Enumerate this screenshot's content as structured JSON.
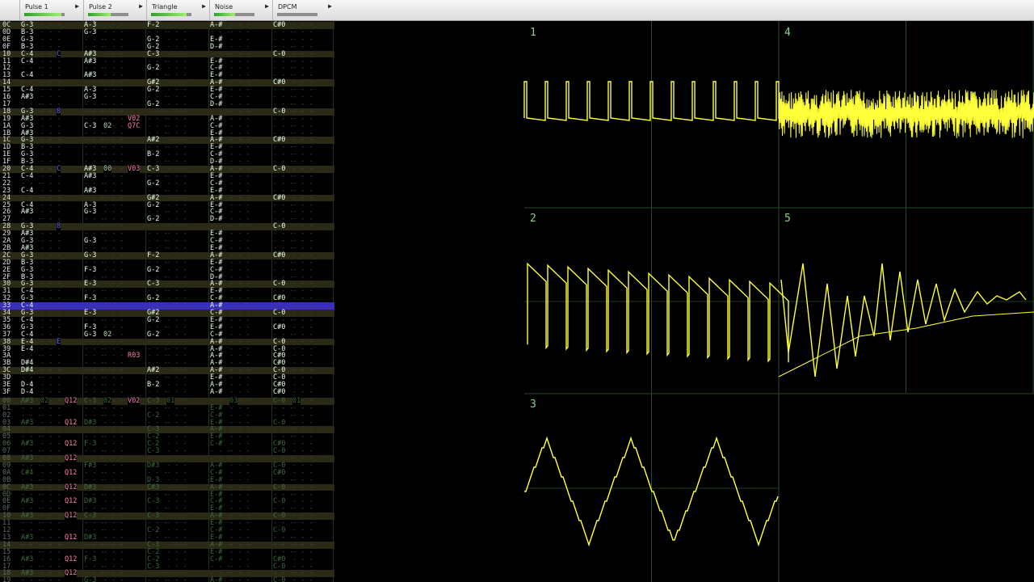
{
  "channels": [
    {
      "name": "Pulse 1",
      "level": 0.92
    },
    {
      "name": "Pulse 2",
      "level": 0.55
    },
    {
      "name": "Triangle",
      "level": 0.88
    },
    {
      "name": "Noise",
      "level": 0.52
    },
    {
      "name": "DPCM",
      "level": 0.0
    }
  ],
  "empty_cell": "- - -",
  "scope_panels": [
    "1",
    "2",
    "3",
    "4",
    "5"
  ],
  "rows": [
    {
      "r": "0C",
      "c": [
        "G-3",
        "A-3",
        "F-2",
        "A-#",
        "C#0"
      ]
    },
    {
      "r": "0D",
      "c": [
        "B-3",
        "G-3",
        "",
        "",
        ""
      ]
    },
    {
      "r": "0E",
      "c": [
        "G-3",
        "",
        "G-2",
        "E-#",
        ""
      ]
    },
    {
      "r": "0F",
      "c": [
        "B-3",
        "",
        "G-2",
        "D-#",
        ""
      ]
    },
    {
      "r": "10",
      "c": [
        "C-4",
        "A#3",
        "C-3",
        "",
        "C-0"
      ]
    },
    {
      "r": "11",
      "c": [
        "C-4",
        "A#3",
        "",
        "E-#",
        ""
      ]
    },
    {
      "r": "12",
      "c": [
        "",
        "",
        "G-2",
        "C-#",
        ""
      ]
    },
    {
      "r": "13",
      "c": [
        "C-4",
        "A#3",
        "",
        "E-#",
        ""
      ]
    },
    {
      "r": "14",
      "c": [
        "",
        "",
        "G#2",
        "A-#",
        "C#0"
      ]
    },
    {
      "r": "15",
      "c": [
        "C-4",
        "A-3",
        "G-2",
        "E-#",
        ""
      ]
    },
    {
      "r": "16",
      "c": [
        "A#3",
        "G-3",
        "",
        "C-#",
        ""
      ]
    },
    {
      "r": "17",
      "c": [
        "",
        "",
        "G-2",
        "D-#",
        ""
      ]
    },
    {
      "r": "18",
      "c": [
        "G-3",
        "",
        "",
        "",
        "C-0"
      ]
    },
    {
      "r": "19",
      "c": [
        "A#3",
        "",
        "",
        "A-#",
        ""
      ]
    },
    {
      "r": "1A",
      "c": [
        "G-3",
        "C-3",
        "",
        "C-#",
        ""
      ]
    },
    {
      "r": "1B",
      "c": [
        "A#3",
        "",
        "",
        "E-#",
        ""
      ]
    },
    {
      "r": "1C",
      "c": [
        "G-3",
        "",
        "A#2",
        "A-#",
        "C#0"
      ]
    },
    {
      "r": "1D",
      "c": [
        "B-3",
        "",
        "",
        "E-#",
        ""
      ]
    },
    {
      "r": "1E",
      "c": [
        "G-3",
        "",
        "B-2",
        "C-#",
        ""
      ]
    },
    {
      "r": "1F",
      "c": [
        "B-3",
        "",
        "",
        "D-#",
        ""
      ]
    },
    {
      "r": "20",
      "c": [
        "C-4",
        "A#3",
        "C-3",
        "A-#",
        "C-0"
      ]
    },
    {
      "r": "21",
      "c": [
        "C-4",
        "A#3",
        "",
        "E-#",
        ""
      ]
    },
    {
      "r": "22",
      "c": [
        "",
        "",
        "G-2",
        "C-#",
        ""
      ]
    },
    {
      "r": "23",
      "c": [
        "C-4",
        "A#3",
        "",
        "E-#",
        ""
      ]
    },
    {
      "r": "24",
      "c": [
        "",
        "",
        "G#2",
        "A-#",
        "C#0"
      ]
    },
    {
      "r": "25",
      "c": [
        "C-4",
        "A-3",
        "G-2",
        "E-#",
        ""
      ]
    },
    {
      "r": "26",
      "c": [
        "A#3",
        "G-3",
        "",
        "C-#",
        ""
      ]
    },
    {
      "r": "27",
      "c": [
        "",
        "",
        "G-2",
        "D-#",
        ""
      ]
    },
    {
      "r": "28",
      "c": [
        "G-3",
        "",
        "",
        "",
        "C-0"
      ]
    },
    {
      "r": "29",
      "c": [
        "A#3",
        "",
        "",
        "E-#",
        ""
      ]
    },
    {
      "r": "2A",
      "c": [
        "G-3",
        "G-3",
        "",
        "C-#",
        ""
      ]
    },
    {
      "r": "2B",
      "c": [
        "A#3",
        "",
        "",
        "E-#",
        ""
      ]
    },
    {
      "r": "2C",
      "c": [
        "G-3",
        "G-3",
        "F-2",
        "A-#",
        "C#0"
      ]
    },
    {
      "r": "2D",
      "c": [
        "B-3",
        "",
        "",
        "E-#",
        ""
      ]
    },
    {
      "r": "2E",
      "c": [
        "G-3",
        "F-3",
        "G-2",
        "C-#",
        ""
      ]
    },
    {
      "r": "2F",
      "c": [
        "B-3",
        "",
        "",
        "D-#",
        ""
      ]
    },
    {
      "r": "30",
      "c": [
        "G-3",
        "E-3",
        "C-3",
        "A-#",
        "C-0"
      ]
    },
    {
      "r": "31",
      "c": [
        "C-4",
        "",
        "",
        "E-#",
        ""
      ]
    },
    {
      "r": "32",
      "c": [
        "G-3",
        "F-3",
        "G-2",
        "C-#",
        "C#0"
      ]
    },
    {
      "r": "33",
      "c": [
        "C-4",
        "",
        "",
        "A-#",
        ""
      ]
    },
    {
      "r": "34",
      "c": [
        "G-3",
        "E-3",
        "G#2",
        "C-#",
        "C-0"
      ]
    },
    {
      "r": "35",
      "c": [
        "C-4",
        "",
        "G-2",
        "E-#",
        ""
      ]
    },
    {
      "r": "36",
      "c": [
        "G-3",
        "F-3",
        "",
        "E-#",
        "C#0"
      ]
    },
    {
      "r": "37",
      "c": [
        "C-4",
        "G-3",
        "G-2",
        "C-#",
        ""
      ]
    },
    {
      "r": "38",
      "c": [
        "E-4",
        "",
        "",
        "A-#",
        "C-0"
      ]
    },
    {
      "r": "39",
      "c": [
        "E-4",
        "",
        "",
        "A-#",
        "C-0"
      ]
    },
    {
      "r": "3A",
      "c": [
        "",
        "",
        "",
        "A-#",
        "C#0"
      ]
    },
    {
      "r": "3B",
      "c": [
        "D#4",
        "",
        "",
        "A-#",
        "C#0"
      ]
    },
    {
      "r": "3C",
      "c": [
        "D#4",
        "",
        "A#2",
        "A-#",
        "C-0"
      ]
    },
    {
      "r": "3D",
      "c": [
        "",
        "",
        "",
        "E-#",
        "C-0"
      ]
    },
    {
      "r": "3E",
      "c": [
        "D-4",
        "",
        "B-2",
        "A-#",
        "C#0"
      ]
    },
    {
      "r": "3F",
      "c": [
        "D-4",
        "",
        "",
        "A-#",
        "C#0"
      ]
    }
  ],
  "rows_next": [
    {
      "r": "00",
      "c": [
        "A#3",
        "C-3",
        "C-3",
        "",
        "C-0"
      ]
    },
    {
      "r": "01",
      "c": [
        "",
        "",
        "",
        "E-#",
        ""
      ]
    },
    {
      "r": "02",
      "c": [
        "",
        "",
        "C-2",
        "C-#",
        ""
      ]
    },
    {
      "r": "03",
      "c": [
        "A#3",
        "D#3",
        "",
        "E-#",
        "C-0"
      ]
    },
    {
      "r": "04",
      "c": [
        "",
        "",
        "C-3",
        "A-#",
        ""
      ]
    },
    {
      "r": "05",
      "c": [
        "",
        "",
        "C-2",
        "E-#",
        ""
      ]
    },
    {
      "r": "06",
      "c": [
        "A#3",
        "F-3",
        "C-2",
        "C-#",
        "C#0"
      ]
    },
    {
      "r": "07",
      "c": [
        "",
        "",
        "C-3",
        "",
        "C-0"
      ]
    },
    {
      "r": "08",
      "c": [
        "A#3",
        "",
        "",
        "",
        ""
      ]
    },
    {
      "r": "09",
      "c": [
        "",
        "F#3",
        "D#3",
        "A-#",
        "C-0"
      ]
    },
    {
      "r": "0A",
      "c": [
        "C#4",
        "",
        "",
        "C-#",
        "C#0"
      ]
    },
    {
      "r": "0B",
      "c": [
        "",
        "",
        "D-3",
        "E-#",
        ""
      ]
    },
    {
      "r": "0C",
      "c": [
        "A#3",
        "D#3",
        "C#3",
        "A-#",
        "C-0"
      ]
    },
    {
      "r": "0D",
      "c": [
        "",
        "",
        "",
        "E-#",
        ""
      ]
    },
    {
      "r": "0E",
      "c": [
        "A#3",
        "D#3",
        "C-3",
        "C-#",
        "C-0"
      ]
    },
    {
      "r": "0F",
      "c": [
        "",
        "",
        "",
        "E-#",
        ""
      ]
    },
    {
      "r": "10",
      "c": [
        "A#3",
        "C-3",
        "C-3",
        "A-#",
        "C-0"
      ]
    },
    {
      "r": "11",
      "c": [
        "",
        "",
        "",
        "E-#",
        ""
      ]
    },
    {
      "r": "12",
      "c": [
        "",
        "",
        "C-2",
        "C-#",
        "C-0"
      ]
    },
    {
      "r": "13",
      "c": [
        "A#3",
        "D#3",
        "",
        "E-#",
        ""
      ]
    },
    {
      "r": "14",
      "c": [
        "",
        "",
        "C-3",
        "A-#",
        ""
      ]
    },
    {
      "r": "15",
      "c": [
        "",
        "",
        "C-2",
        "E-#",
        ""
      ]
    },
    {
      "r": "16",
      "c": [
        "A#3",
        "F-3",
        "C-2",
        "C-#",
        "C#0"
      ]
    },
    {
      "r": "17",
      "c": [
        "",
        "",
        "C-3",
        "",
        "C-0"
      ]
    },
    {
      "r": "18",
      "c": [
        "A#3",
        "",
        "",
        "",
        ""
      ]
    },
    {
      "r": "19",
      "c": [
        "",
        "G-3",
        "",
        "A-#",
        "C-0"
      ]
    }
  ],
  "extras": [
    {
      "row": 4,
      "col": 0,
      "off": 44,
      "text": "C",
      "cls": "fx-p"
    },
    {
      "row": 12,
      "col": 0,
      "off": 44,
      "text": "8",
      "cls": "fx-p"
    },
    {
      "row": 20,
      "col": 0,
      "off": 44,
      "text": "C",
      "cls": "fx-p"
    },
    {
      "row": 28,
      "col": 0,
      "off": 44,
      "text": "8",
      "cls": "fx-p"
    },
    {
      "row": 44,
      "col": 0,
      "off": 44,
      "text": "E",
      "cls": "fx-p"
    },
    {
      "row": 13,
      "col": 1,
      "off": 54,
      "text": "V02",
      "cls": "fx-v"
    },
    {
      "row": 14,
      "col": 1,
      "off": 24,
      "text": "02",
      "cls": "inst"
    },
    {
      "row": 14,
      "col": 1,
      "off": 54,
      "text": "Q7C",
      "cls": "fx-v"
    },
    {
      "row": 20,
      "col": 1,
      "off": 24,
      "text": "00",
      "cls": "inst"
    },
    {
      "row": 20,
      "col": 1,
      "off": 54,
      "text": "V03",
      "cls": "fx-v"
    },
    {
      "row": 43,
      "col": 1,
      "off": 24,
      "text": "02",
      "cls": "inst"
    },
    {
      "row": 46,
      "col": 1,
      "off": 54,
      "text": "R03",
      "cls": "fx-v"
    }
  ],
  "extras_next": [
    {
      "row": 0,
      "col": 0,
      "off": 24,
      "text": "02",
      "cls": "inst"
    },
    {
      "row": 0,
      "col": 0,
      "off": 54,
      "text": "Q12",
      "cls": "fx-v"
    },
    {
      "row": 0,
      "col": 1,
      "off": 24,
      "text": "02",
      "cls": "inst"
    },
    {
      "row": 0,
      "col": 1,
      "off": 54,
      "text": "V02",
      "cls": "fx-v"
    },
    {
      "row": 0,
      "col": 2,
      "off": 24,
      "text": "01",
      "cls": "inst"
    },
    {
      "row": 0,
      "col": 3,
      "off": 24,
      "text": "03",
      "cls": "inst"
    },
    {
      "row": 0,
      "col": 4,
      "off": 24,
      "text": "01",
      "cls": "inst"
    },
    {
      "row": 3,
      "col": 0,
      "off": 54,
      "text": "Q12",
      "cls": "fx-v"
    },
    {
      "row": 6,
      "col": 0,
      "off": 54,
      "text": "Q12",
      "cls": "fx-v"
    },
    {
      "row": 8,
      "col": 0,
      "off": 54,
      "text": "Q12",
      "cls": "fx-v"
    },
    {
      "row": 10,
      "col": 0,
      "off": 54,
      "text": "Q12",
      "cls": "fx-v"
    },
    {
      "row": 12,
      "col": 0,
      "off": 54,
      "text": "Q12",
      "cls": "fx-v"
    },
    {
      "row": 14,
      "col": 0,
      "off": 54,
      "text": "Q12",
      "cls": "fx-v"
    },
    {
      "row": 16,
      "col": 0,
      "off": 54,
      "text": "Q12",
      "cls": "fx-v"
    },
    {
      "row": 19,
      "col": 0,
      "off": 54,
      "text": "Q12",
      "cls": "fx-v"
    },
    {
      "row": 22,
      "col": 0,
      "off": 54,
      "text": "Q12",
      "cls": "fx-v"
    },
    {
      "row": 24,
      "col": 0,
      "off": 54,
      "text": "Q12",
      "cls": "fx-v"
    }
  ],
  "colors": {
    "trace": "#ffff3a",
    "grid": "#2a4a2a",
    "label": "#8fcf8f",
    "cursor_row": "#3a2fb8"
  }
}
